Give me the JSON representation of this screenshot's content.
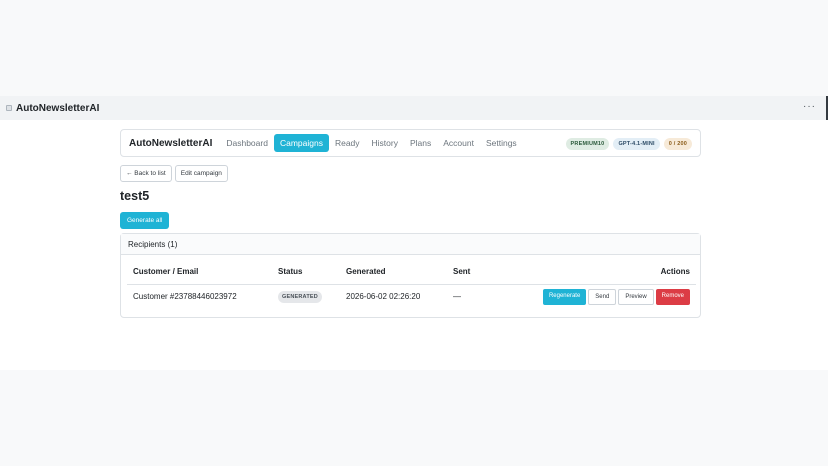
{
  "window": {
    "title": "AutoNewsletterAI",
    "more": "···"
  },
  "nav": {
    "brand": "AutoNewsletterAI",
    "links": [
      "Dashboard",
      "Campaigns",
      "Ready",
      "History",
      "Plans",
      "Account",
      "Settings"
    ],
    "active": "Campaigns",
    "badges": [
      "PREMIUM10",
      "GPT-4.1-MINI",
      "0 / 200"
    ]
  },
  "toolbar": {
    "back": "← Back to list",
    "edit": "Edit campaign"
  },
  "page": {
    "title": "test5",
    "generate_all": "Generate all"
  },
  "recipients": {
    "title": "Recipients (1)",
    "columns": [
      "Customer / Email",
      "Status",
      "Generated",
      "Sent",
      "Actions"
    ],
    "rows": [
      {
        "customer": "Customer #23788446023972",
        "status": "GENERATED",
        "generated": "2026-06-02 02:26:20",
        "sent": "—"
      }
    ],
    "actions": [
      "Regenerate",
      "Send",
      "Preview",
      "Remove"
    ]
  },
  "colors": {
    "accent": "#1fb3d5",
    "danger": "#dc3c45"
  }
}
